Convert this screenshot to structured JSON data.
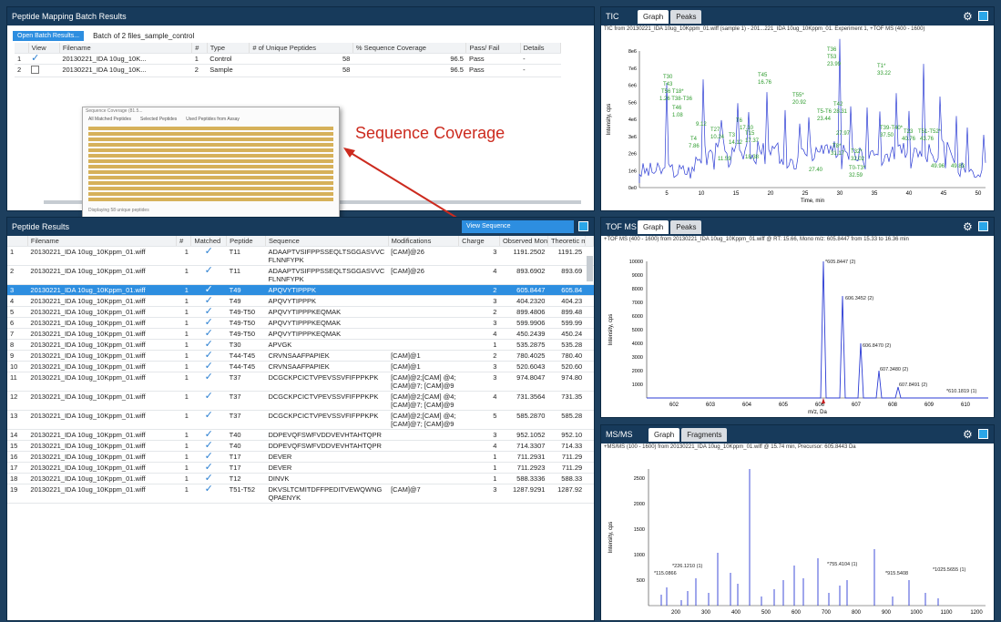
{
  "batch": {
    "title": "Peptide Mapping Batch Results",
    "open_button": "Open Batch Results...",
    "batch_text": "Batch of 2 files_sample_control",
    "headers": [
      "View",
      "Filename",
      "#",
      "Type",
      "# of Unique Peptides",
      "% Sequence Coverage",
      "Pass/ Fail",
      "Details"
    ],
    "rows": [
      {
        "idx": "1",
        "checked": true,
        "file": "20130221_IDA 10ug_10K...",
        "n": "1",
        "type": "Control",
        "unique": "58",
        "coverage": "96.5",
        "pass": "Pass",
        "details": "-"
      },
      {
        "idx": "2",
        "checked": false,
        "file": "20130221_IDA 10ug_10K...",
        "n": "2",
        "type": "Sample",
        "unique": "58",
        "coverage": "96.5",
        "pass": "Pass",
        "details": "-"
      }
    ]
  },
  "popup": {
    "title": "Sequence Coverage (81.5...",
    "tabs": [
      "All Matched Peptides",
      "Selected Peptides",
      "Used Peptides from Assay"
    ],
    "footer": "Displaying 58 unique peptides"
  },
  "annotation": {
    "label": "Sequence Coverage",
    "color": "#cc2a1e"
  },
  "tic": {
    "title": "TIC",
    "tabs": [
      "Graph",
      "Peaks"
    ],
    "caption": "TIC from 20130221_IDA 10ug_10Kppm_01.wiff (sample 1) - 201...221_IDA 10ug_10Kppm_01. Experiment 1, +TOF MS (400 - 1600)",
    "ylabel": "Intensity, cps",
    "xlabel": "Time, min",
    "yticks": [
      "8e6",
      "7e6",
      "6e6",
      "5e6",
      "4e6",
      "3e6",
      "2e6",
      "1e6",
      "0e0"
    ],
    "xticks": [
      "5",
      "10",
      "15",
      "20",
      "25",
      "30",
      "35",
      "40",
      "45",
      "50"
    ],
    "peaks": [
      "T36",
      "T53",
      "23.99",
      "T1*",
      "33.22",
      "T45",
      "16.76",
      "T30",
      "T43",
      "T56 T18*",
      "1.26 T38-T36",
      "T46",
      "1.08",
      "T55*",
      "20.92",
      "T42",
      "28.31",
      "T5-T6",
      "23.44",
      "T4",
      "7.86",
      "9.12",
      "T27",
      "10.24",
      "T6",
      "17.10",
      "T3",
      "14.12",
      "T15",
      "17.37",
      "11.59",
      "18.38",
      "27.40",
      "27.97",
      "T8*",
      "31.17",
      "T32*",
      "32.02",
      "T0-T3*",
      "32.59",
      "T39-T40*",
      "37.50",
      "T23",
      "40.76",
      "T51-T52*",
      "43.76",
      "49.96",
      "49.83"
    ]
  },
  "tofms": {
    "title": "TOF MS",
    "tabs": [
      "Graph",
      "Peaks"
    ],
    "caption": "+TOF MS (400 - 1600) from 20130221_IDA 10ug_10Kppm_01.wiff @ RT: 15.66, Mono m/z: 605.8447 from 15.33 to 16.36 min",
    "ylabel": "Intensity, cps",
    "xlabel": "m/z, Da",
    "yticks": [
      "10000",
      "9000",
      "8000",
      "7000",
      "6000",
      "5000",
      "4000",
      "3000",
      "2000",
      "1000"
    ],
    "xticks": [
      "602",
      "603",
      "604",
      "605",
      "606",
      "607",
      "608",
      "609",
      "610"
    ],
    "labels": [
      "*605.8447 (2)",
      "606.3452 (2)",
      "606.8470 (2)",
      "607.3480 (2)",
      "607.8491 (2)",
      "*610.1819 (1)"
    ]
  },
  "msms": {
    "title": "MS/MS",
    "tabs": [
      "Graph",
      "Fragments"
    ],
    "caption": "+MS/MS (100 - 1600) from 20130221_IDA 10ug_10Kppm_01.wiff @ 15.74 min, Precursor: 605.8443 Da",
    "ylabel": "Intensity, cps",
    "yticks": [
      "2500",
      "2000",
      "1500",
      "1000",
      "500"
    ],
    "xticks": [
      "200",
      "300",
      "400",
      "500",
      "600",
      "700",
      "800",
      "900",
      "1000",
      "1100",
      "1200"
    ],
    "labels": [
      "*226.1210 (1)",
      "*115.0866",
      "*755.4104 (1)",
      "*915.5408",
      "*1025.5655 (1)"
    ]
  },
  "results": {
    "title": "Peptide Results",
    "view_button": "View Sequence",
    "headers": [
      "Filename",
      "#",
      "Matched",
      "Peptide",
      "Sequence",
      "Modifications",
      "Charge",
      "Observed Mono m/z",
      "Theoretic m/z"
    ],
    "rows": [
      {
        "i": "1",
        "file": "20130221_IDA 10ug_10Kppm_01.wiff",
        "n": "1",
        "pep": "T11",
        "seq": "ADAAPTVSIFPPSSEQLTSGGASVVC FLNNFYPK",
        "mod": "[CAM]@26",
        "ch": "3",
        "obs": "1191.2502",
        "th": "1191.25"
      },
      {
        "i": "2",
        "file": "20130221_IDA 10ug_10Kppm_01.wiff",
        "n": "1",
        "pep": "T11",
        "seq": "ADAAPTVSIFPPSSEQLTSGGASVVC FLNNFYPK",
        "mod": "[CAM]@26",
        "ch": "4",
        "obs": "893.6902",
        "th": "893.69"
      },
      {
        "i": "3",
        "file": "20130221_IDA 10ug_10Kppm_01.wiff",
        "n": "1",
        "pep": "T49",
        "seq": "APQVYTIPPPK",
        "mod": "",
        "ch": "2",
        "obs": "605.8447",
        "th": "605.84",
        "sel": true
      },
      {
        "i": "4",
        "file": "20130221_IDA 10ug_10Kppm_01.wiff",
        "n": "1",
        "pep": "T49",
        "seq": "APQVYTIPPPK",
        "mod": "",
        "ch": "3",
        "obs": "404.2320",
        "th": "404.23"
      },
      {
        "i": "5",
        "file": "20130221_IDA 10ug_10Kppm_01.wiff",
        "n": "1",
        "pep": "T49-T50",
        "seq": "APQVYTIPPPKEQMAK",
        "mod": "",
        "ch": "2",
        "obs": "899.4806",
        "th": "899.48"
      },
      {
        "i": "6",
        "file": "20130221_IDA 10ug_10Kppm_01.wiff",
        "n": "1",
        "pep": "T49-T50",
        "seq": "APQVYTIPPPKEQMAK",
        "mod": "",
        "ch": "3",
        "obs": "599.9906",
        "th": "599.99"
      },
      {
        "i": "7",
        "file": "20130221_IDA 10ug_10Kppm_01.wiff",
        "n": "1",
        "pep": "T49-T50",
        "seq": "APQVYTIPPPKEQMAK",
        "mod": "",
        "ch": "4",
        "obs": "450.2439",
        "th": "450.24"
      },
      {
        "i": "8",
        "file": "20130221_IDA 10ug_10Kppm_01.wiff",
        "n": "1",
        "pep": "T30",
        "seq": "APVGK",
        "mod": "",
        "ch": "1",
        "obs": "535.2875",
        "th": "535.28"
      },
      {
        "i": "9",
        "file": "20130221_IDA 10ug_10Kppm_01.wiff",
        "n": "1",
        "pep": "T44-T45",
        "seq": "CRVNSAAFPAPIEK",
        "mod": "[CAM]@1",
        "ch": "2",
        "obs": "780.4025",
        "th": "780.40"
      },
      {
        "i": "10",
        "file": "20130221_IDA 10ug_10Kppm_01.wiff",
        "n": "1",
        "pep": "T44-T45",
        "seq": "CRVNSAAFPAPIEK",
        "mod": "[CAM]@1",
        "ch": "3",
        "obs": "520.6043",
        "th": "520.60"
      },
      {
        "i": "11",
        "file": "20130221_IDA 10ug_10Kppm_01.wiff",
        "n": "1",
        "pep": "T37",
        "seq": "DCGCKPCICTVPEVSSVFIFPPKPK",
        "mod": "[CAM]@2;[CAM] @4;[CAM]@7; [CAM]@9",
        "ch": "3",
        "obs": "974.8047",
        "th": "974.80"
      },
      {
        "i": "12",
        "file": "20130221_IDA 10ug_10Kppm_01.wiff",
        "n": "1",
        "pep": "T37",
        "seq": "DCGCKPCICTVPEVSSVFIFPPKPK",
        "mod": "[CAM]@2;[CAM] @4;[CAM]@7; [CAM]@9",
        "ch": "4",
        "obs": "731.3564",
        "th": "731.35"
      },
      {
        "i": "13",
        "file": "20130221_IDA 10ug_10Kppm_01.wiff",
        "n": "1",
        "pep": "T37",
        "seq": "DCGCKPCICTVPEVSSVFIFPPKPK",
        "mod": "[CAM]@2;[CAM] @4;[CAM]@7; [CAM]@9",
        "ch": "5",
        "obs": "585.2870",
        "th": "585.28"
      },
      {
        "i": "14",
        "file": "20130221_IDA 10ug_10Kppm_01.wiff",
        "n": "1",
        "pep": "T40",
        "seq": "DDPEVQFSWFVDDVEVHTAHTQPR",
        "mod": "",
        "ch": "3",
        "obs": "952.1052",
        "th": "952.10"
      },
      {
        "i": "15",
        "file": "20130221_IDA 10ug_10Kppm_01.wiff",
        "n": "1",
        "pep": "T40",
        "seq": "DDPEVQFSWFVDDVEVHTAHTQPR",
        "mod": "",
        "ch": "4",
        "obs": "714.3307",
        "th": "714.33"
      },
      {
        "i": "16",
        "file": "20130221_IDA 10ug_10Kppm_01.wiff",
        "n": "1",
        "pep": "T17",
        "seq": "DEVER",
        "mod": "",
        "ch": "1",
        "obs": "711.2931",
        "th": "711.29"
      },
      {
        "i": "17",
        "file": "20130221_IDA 10ug_10Kppm_01.wiff",
        "n": "1",
        "pep": "T17",
        "seq": "DEVER",
        "mod": "",
        "ch": "1",
        "obs": "711.2923",
        "th": "711.29"
      },
      {
        "i": "18",
        "file": "20130221_IDA 10ug_10Kppm_01.wiff",
        "n": "1",
        "pep": "T12",
        "seq": "DINVK",
        "mod": "",
        "ch": "1",
        "obs": "588.3336",
        "th": "588.33"
      },
      {
        "i": "19",
        "file": "20130221_IDA 10ug_10Kppm_01.wiff",
        "n": "1",
        "pep": "T51-T52",
        "seq": "DKVSLTCMITDFFPEDITVEWQWNG QPAENYK",
        "mod": "[CAM]@7",
        "ch": "3",
        "obs": "1287.9291",
        "th": "1287.92"
      }
    ]
  }
}
